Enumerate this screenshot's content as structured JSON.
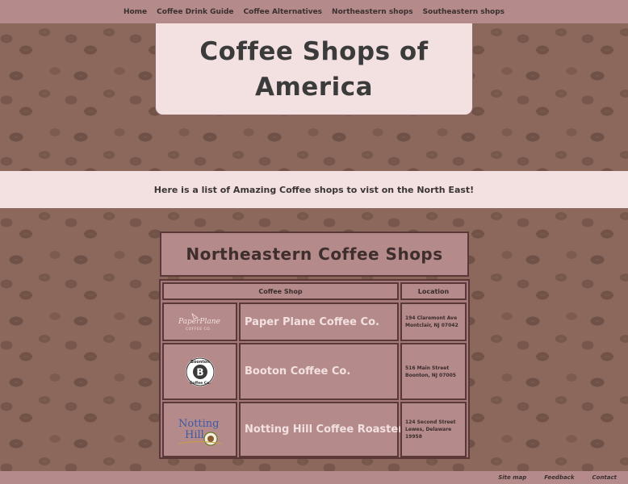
{
  "nav": {
    "items": [
      "Home",
      "Coffee Drink Guide",
      "Coffee Alternatives",
      "Northeastern shops",
      "Southeastern shops"
    ]
  },
  "hero": {
    "title_line1": "Coffee Shops of",
    "title_line2": "America"
  },
  "banner": {
    "text": "Here is a list of Amazing Coffee shops to vist on the North East!"
  },
  "section": {
    "heading": "Northeastern Coffee Shops"
  },
  "table": {
    "headers": [
      "Coffee Shop",
      "Location"
    ],
    "rows": [
      {
        "logo_text_line1": "PaperPlane",
        "logo_text_line2": "COFFEE CO.",
        "name": "Paper Plane Coffee Co.",
        "address_line1": "194 Claremont Ave",
        "address_line2": "Montclair, NJ 07042"
      },
      {
        "logo_text_line1": "Boonton",
        "logo_text_line2": "Coffee Co.",
        "logo_letter": "B",
        "name": "Booton Coffee Co.",
        "address_line1": "516 Main Street",
        "address_line2": "Boonton, NJ 07005"
      },
      {
        "logo_text_line1": "Notting",
        "logo_text_line2": "Hill",
        "name": "Notting Hill Coffee Roastery",
        "address_line1": "124 Second Street",
        "address_line2": "Lewes, Delaware 19958"
      }
    ]
  },
  "footer": {
    "links": [
      "Site map",
      "Feedback",
      "Contact"
    ]
  },
  "colors": {
    "nav_bg": "#b58a8a",
    "panel_light": "#f3e1e1",
    "panel_dark": "#b58a8a",
    "border": "#5a3838"
  }
}
